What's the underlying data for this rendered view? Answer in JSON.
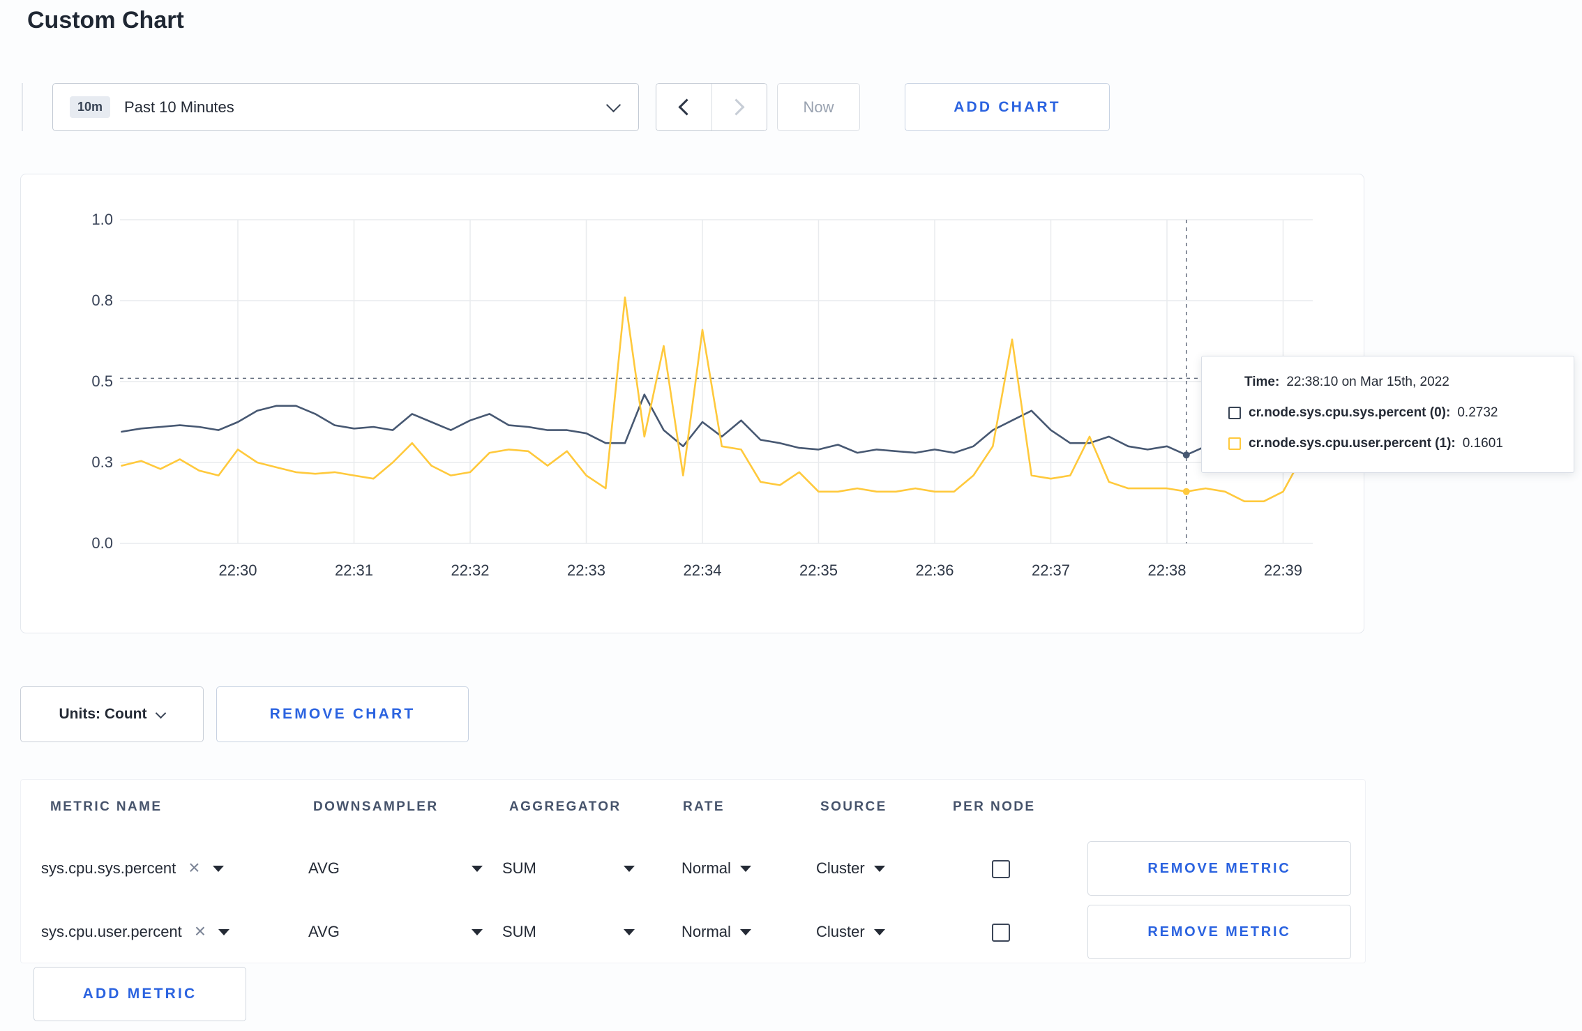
{
  "page": {
    "title": "Custom Chart"
  },
  "colors": {
    "accent_blue": "#2b63e0",
    "series_sys": "#475872",
    "series_user": "#ffc93c"
  },
  "icons": {
    "clear": "×"
  },
  "toolbar": {
    "time_badge": "10m",
    "time_label": "Past 10 Minutes",
    "now_label": "Now",
    "add_chart_label": "ADD CHART"
  },
  "chart_controls": {
    "units_label": "Units: Count",
    "remove_chart_label": "REMOVE CHART"
  },
  "tooltip": {
    "time_label": "Time:",
    "time_value": "22:38:10 on Mar 15th, 2022",
    "series": [
      {
        "label": "cr.node.sys.cpu.sys.percent (0):",
        "value": "0.2732",
        "color": "#394455"
      },
      {
        "label": "cr.node.sys.cpu.user.percent (1):",
        "value": "0.1601",
        "color": "#ffc93c"
      }
    ]
  },
  "metrics_table": {
    "headers": [
      "METRIC NAME",
      "DOWNSAMPLER",
      "AGGREGATOR",
      "RATE",
      "SOURCE",
      "PER NODE"
    ],
    "rows": [
      {
        "metric": "sys.cpu.sys.percent",
        "downsampler": "AVG",
        "aggregator": "SUM",
        "rate": "Normal",
        "source": "Cluster",
        "per_node": false,
        "remove_label": "REMOVE METRIC"
      },
      {
        "metric": "sys.cpu.user.percent",
        "downsampler": "AVG",
        "aggregator": "SUM",
        "rate": "Normal",
        "source": "Cluster",
        "per_node": false,
        "remove_label": "REMOVE METRIC"
      }
    ],
    "add_metric_label": "ADD METRIC"
  },
  "chart_data": {
    "type": "line",
    "ylim": [
      0,
      1
    ],
    "grid": true,
    "y_ticks": [
      {
        "value": 0,
        "label": "0.0"
      },
      {
        "value": 0.25,
        "label": "0.3"
      },
      {
        "value": 0.5,
        "label": "0.5"
      },
      {
        "value": 0.75,
        "label": "0.8"
      },
      {
        "value": 1,
        "label": "1.0"
      }
    ],
    "x_ticks": [
      {
        "seconds": 0,
        "label": "22:30"
      },
      {
        "seconds": 60,
        "label": "22:31"
      },
      {
        "seconds": 120,
        "label": "22:32"
      },
      {
        "seconds": 180,
        "label": "22:33"
      },
      {
        "seconds": 240,
        "label": "22:34"
      },
      {
        "seconds": 300,
        "label": "22:35"
      },
      {
        "seconds": 360,
        "label": "22:36"
      },
      {
        "seconds": 420,
        "label": "22:37"
      },
      {
        "seconds": 480,
        "label": "22:38"
      },
      {
        "seconds": 540,
        "label": "22:39"
      }
    ],
    "crosshair": {
      "time_seconds": 490,
      "time_label": "22:38:10",
      "hline_value": 0.51,
      "points": [
        {
          "series": 0,
          "value": 0.2732
        },
        {
          "series": 1,
          "value": 0.1601
        }
      ]
    },
    "series": [
      {
        "name": "cr.node.sys.cpu.sys.percent",
        "color": "#475872",
        "points": [
          [
            -60,
            0.345
          ],
          [
            -50,
            0.355
          ],
          [
            -40,
            0.36
          ],
          [
            -30,
            0.365
          ],
          [
            -20,
            0.36
          ],
          [
            -10,
            0.35
          ],
          [
            0,
            0.375
          ],
          [
            10,
            0.41
          ],
          [
            20,
            0.425
          ],
          [
            30,
            0.425
          ],
          [
            40,
            0.4
          ],
          [
            50,
            0.365
          ],
          [
            60,
            0.355
          ],
          [
            70,
            0.36
          ],
          [
            80,
            0.35
          ],
          [
            90,
            0.4
          ],
          [
            100,
            0.375
          ],
          [
            110,
            0.35
          ],
          [
            120,
            0.38
          ],
          [
            130,
            0.4
          ],
          [
            140,
            0.365
          ],
          [
            150,
            0.36
          ],
          [
            160,
            0.35
          ],
          [
            170,
            0.35
          ],
          [
            180,
            0.34
          ],
          [
            190,
            0.31
          ],
          [
            200,
            0.31
          ],
          [
            210,
            0.46
          ],
          [
            220,
            0.35
          ],
          [
            230,
            0.3
          ],
          [
            240,
            0.375
          ],
          [
            250,
            0.33
          ],
          [
            260,
            0.38
          ],
          [
            270,
            0.32
          ],
          [
            280,
            0.31
          ],
          [
            290,
            0.295
          ],
          [
            300,
            0.29
          ],
          [
            310,
            0.305
          ],
          [
            320,
            0.28
          ],
          [
            330,
            0.29
          ],
          [
            340,
            0.285
          ],
          [
            350,
            0.28
          ],
          [
            360,
            0.29
          ],
          [
            370,
            0.28
          ],
          [
            380,
            0.3
          ],
          [
            390,
            0.35
          ],
          [
            400,
            0.38
          ],
          [
            410,
            0.41
          ],
          [
            420,
            0.35
          ],
          [
            430,
            0.31
          ],
          [
            440,
            0.31
          ],
          [
            450,
            0.33
          ],
          [
            460,
            0.3
          ],
          [
            470,
            0.29
          ],
          [
            480,
            0.3
          ],
          [
            490,
            0.2732
          ],
          [
            500,
            0.3
          ],
          [
            510,
            0.315
          ],
          [
            520,
            0.3
          ],
          [
            530,
            0.295
          ],
          [
            540,
            0.3
          ],
          [
            550,
            0.31
          ]
        ]
      },
      {
        "name": "cr.node.sys.cpu.user.percent",
        "color": "#ffc93c",
        "points": [
          [
            -60,
            0.24
          ],
          [
            -50,
            0.255
          ],
          [
            -40,
            0.23
          ],
          [
            -30,
            0.26
          ],
          [
            -20,
            0.225
          ],
          [
            -10,
            0.21
          ],
          [
            0,
            0.29
          ],
          [
            10,
            0.25
          ],
          [
            20,
            0.235
          ],
          [
            30,
            0.22
          ],
          [
            40,
            0.215
          ],
          [
            50,
            0.22
          ],
          [
            60,
            0.21
          ],
          [
            70,
            0.2
          ],
          [
            80,
            0.25
          ],
          [
            90,
            0.31
          ],
          [
            100,
            0.24
          ],
          [
            110,
            0.21
          ],
          [
            120,
            0.22
          ],
          [
            130,
            0.28
          ],
          [
            140,
            0.29
          ],
          [
            150,
            0.285
          ],
          [
            160,
            0.24
          ],
          [
            170,
            0.285
          ],
          [
            180,
            0.21
          ],
          [
            190,
            0.17
          ],
          [
            200,
            0.76
          ],
          [
            210,
            0.33
          ],
          [
            220,
            0.61
          ],
          [
            230,
            0.21
          ],
          [
            240,
            0.66
          ],
          [
            250,
            0.3
          ],
          [
            260,
            0.29
          ],
          [
            270,
            0.19
          ],
          [
            280,
            0.18
          ],
          [
            290,
            0.22
          ],
          [
            300,
            0.16
          ],
          [
            310,
            0.16
          ],
          [
            320,
            0.17
          ],
          [
            330,
            0.16
          ],
          [
            340,
            0.16
          ],
          [
            350,
            0.17
          ],
          [
            360,
            0.16
          ],
          [
            370,
            0.16
          ],
          [
            380,
            0.21
          ],
          [
            390,
            0.3
          ],
          [
            400,
            0.63
          ],
          [
            410,
            0.21
          ],
          [
            420,
            0.2
          ],
          [
            430,
            0.21
          ],
          [
            440,
            0.33
          ],
          [
            450,
            0.19
          ],
          [
            460,
            0.17
          ],
          [
            470,
            0.17
          ],
          [
            480,
            0.17
          ],
          [
            490,
            0.1601
          ],
          [
            500,
            0.17
          ],
          [
            510,
            0.16
          ],
          [
            520,
            0.13
          ],
          [
            530,
            0.13
          ],
          [
            540,
            0.16
          ],
          [
            550,
            0.27
          ]
        ]
      }
    ]
  }
}
